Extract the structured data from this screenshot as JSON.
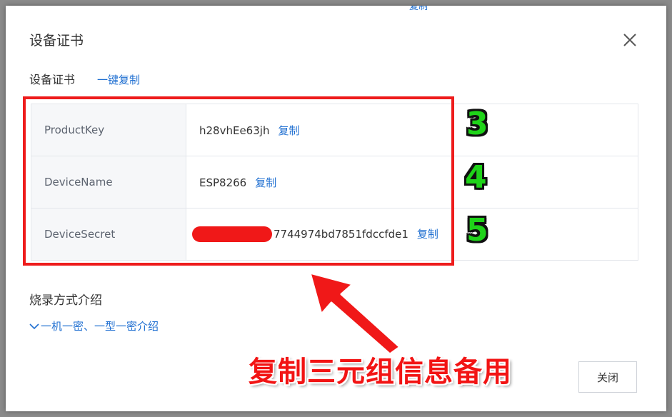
{
  "dialog": {
    "top_partial_text": "复制",
    "title": "设备证书",
    "close_icon": "close-icon"
  },
  "certificate": {
    "section_label": "设备证书",
    "copy_all_link": "一键复制",
    "rows": [
      {
        "key": "ProductKey",
        "value": "h28vhEe63jh",
        "copy": "复制"
      },
      {
        "key": "DeviceName",
        "value": "ESP8266",
        "copy": "复制"
      },
      {
        "key": "DeviceSecret",
        "value": "7744974bd7851fdccfde1",
        "copy": "复制"
      }
    ]
  },
  "annotations": {
    "numbers": [
      "3",
      "4",
      "5"
    ],
    "banner": "复制三元组信息备用",
    "highlight_color": "#ee1c1c",
    "number_color": "#1fd319"
  },
  "burn": {
    "label": "烧录方式介绍",
    "expand_link": "一机一密、一型一密介绍"
  },
  "footer": {
    "close_button": "关闭"
  }
}
